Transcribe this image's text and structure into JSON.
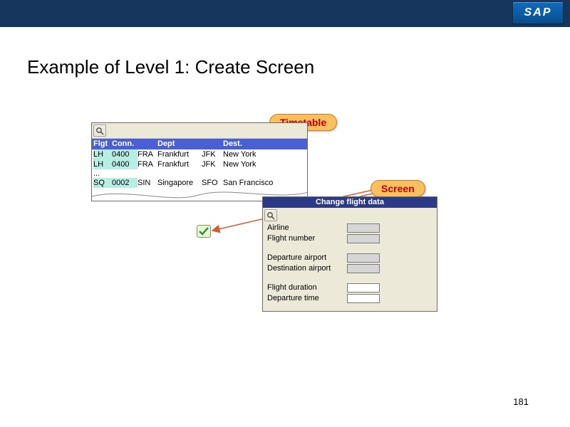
{
  "brand": "SAP",
  "page_title": "Example of Level 1: Create Screen",
  "page_number": "181",
  "callouts": {
    "timetable": "Timetable",
    "screen": "Screen"
  },
  "timetable": {
    "headers": {
      "flgt": "Flgt",
      "conn": "Conn.",
      "dept": "Dept",
      "dest": "Dest."
    },
    "rows": [
      {
        "carrier": "LH",
        "conn": "0400",
        "dep_code": "FRA",
        "dep_city": "Frankfurt",
        "dest_code": "JFK",
        "dest_city": "New York"
      },
      {
        "carrier": "LH",
        "conn": "0400",
        "dep_code": "FRA",
        "dep_city": "Frankfurt",
        "dest_code": "JFK",
        "dest_city": "New York"
      }
    ],
    "ellipsis": "...",
    "last_row": {
      "carrier": "SQ",
      "conn": "0002",
      "dep_code": "SIN",
      "dep_city": "Singapore",
      "dest_code": "SFO",
      "dest_city": "San Francisco"
    }
  },
  "screen": {
    "title": "Change flight data",
    "fields": {
      "airline": "Airline",
      "flight_number": "Flight number",
      "departure_airport": "Departure airport",
      "destination_airport": "Destination airport",
      "flight_duration": "Flight duration",
      "departure_time": "Departure time"
    }
  }
}
